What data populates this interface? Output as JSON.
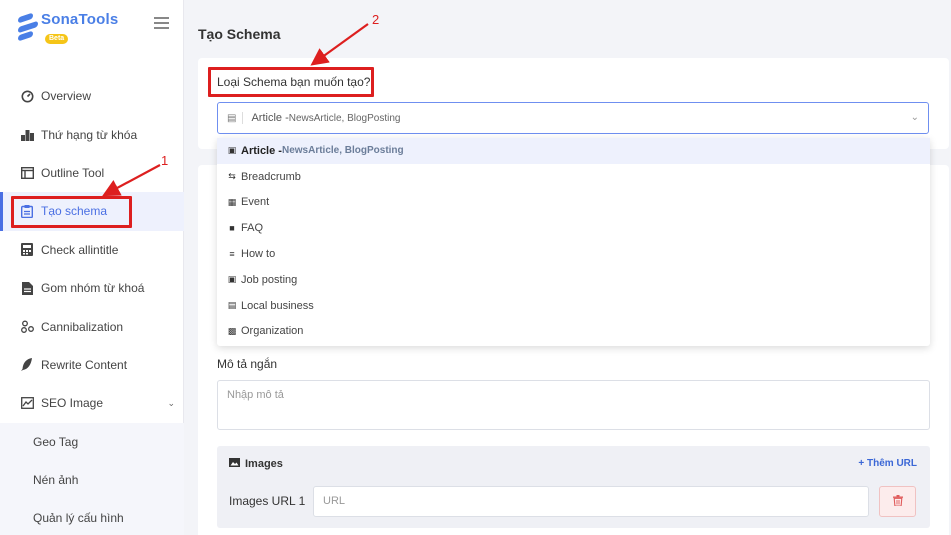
{
  "app": {
    "logo_name": "SonaTools",
    "logo_badge": "Beta",
    "brand_color": "#4a7fe6"
  },
  "sidebar": {
    "items": [
      {
        "label": "Overview",
        "icon": "gauge-icon"
      },
      {
        "label": "Thứ hạng từ khóa",
        "icon": "ranking-icon"
      },
      {
        "label": "Outline Tool",
        "icon": "outline-icon"
      },
      {
        "label": "Tạo schema",
        "icon": "clipboard-icon",
        "active": true
      },
      {
        "label": "Check allintitle",
        "icon": "calculator-icon"
      },
      {
        "label": "Gom nhóm từ khoá",
        "icon": "document-icon"
      },
      {
        "label": "Cannibalization",
        "icon": "nodes-icon"
      },
      {
        "label": "Rewrite Content",
        "icon": "feather-icon"
      },
      {
        "label": "SEO Image",
        "icon": "image-chart-icon",
        "expanded": true
      }
    ],
    "sub_items": [
      {
        "label": "Geo Tag"
      },
      {
        "label": "Nén ảnh"
      },
      {
        "label": "Quản lý cấu hình"
      }
    ]
  },
  "main": {
    "title": "Tạo Schema",
    "schema_question": "Loại Schema bạn muốn tạo?",
    "select": {
      "value_main": "Article -",
      "value_sub": "NewsArticle, BlogPosting"
    },
    "dropdown": [
      {
        "label": "Article -",
        "sub": "NewsArticle, BlogPosting",
        "icon": "article-icon",
        "selected": true
      },
      {
        "label": "Breadcrumb",
        "icon": "arrows-icon"
      },
      {
        "label": "Event",
        "icon": "calendar-icon"
      },
      {
        "label": "FAQ",
        "icon": "question-icon"
      },
      {
        "label": "How to",
        "icon": "list-icon"
      },
      {
        "label": "Job posting",
        "icon": "job-icon"
      },
      {
        "label": "Local business",
        "icon": "store-icon"
      },
      {
        "label": "Organization",
        "icon": "building-icon"
      }
    ],
    "description": {
      "label": "Mô tả ngắn",
      "placeholder": "Nhập mô tả"
    },
    "images": {
      "title": "Images",
      "add_label": "+ Thêm URL",
      "url_label": "Images URL 1",
      "url_placeholder": "URL"
    }
  },
  "annotations": {
    "num1": "1",
    "num2": "2",
    "color": "#dd1f1f"
  }
}
